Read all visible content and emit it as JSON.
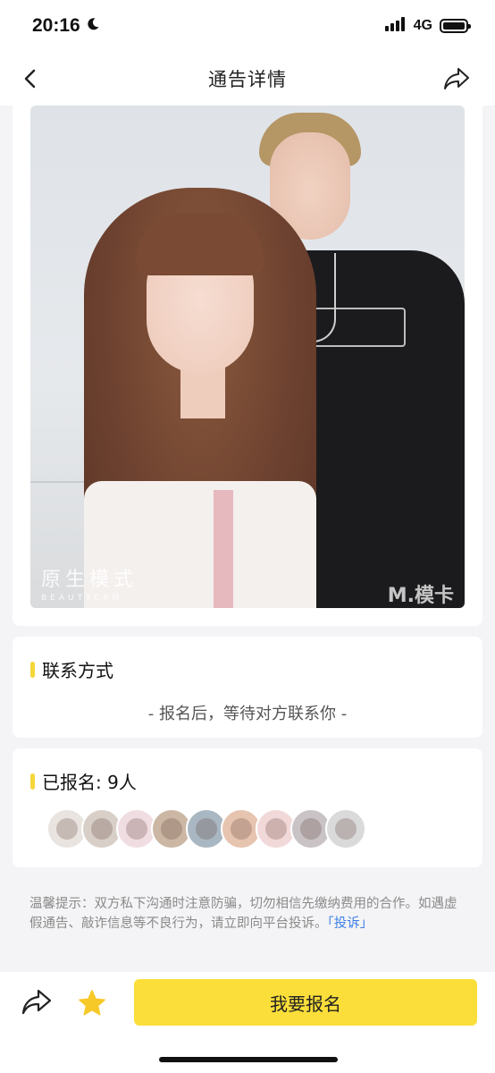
{
  "status_bar": {
    "time": "20:16",
    "network": "4G",
    "icons": [
      "moon-icon",
      "signal-icon",
      "battery-icon"
    ]
  },
  "nav": {
    "title": "通告详情",
    "icons": [
      "back-arrow-icon",
      "share-icon"
    ]
  },
  "photo": {
    "watermark_left_main": "原生模式",
    "watermark_left_sub": "BEAUTYCAM",
    "watermark_right": "M.模卡"
  },
  "contact": {
    "title": "联系方式",
    "note": "- 报名后，等待对方联系你 -"
  },
  "signup": {
    "title": "已报名: 9人",
    "avatar_count": 9,
    "avatar_colors": [
      "#e9e4df",
      "#d8cfc8",
      "#f0dde2",
      "#cbb7a4",
      "#a9b7c2",
      "#e6c4b0",
      "#f2d9d9",
      "#c9c3c6",
      "#dadada"
    ]
  },
  "tip": {
    "text": "温馨提示：双方私下沟通时注意防骗，切勿相信先缴纳费用的合作。如遇虚假通告、敲诈信息等不良行为，请立即向平台投诉。",
    "link": "「投诉」"
  },
  "bottom": {
    "apply_label": "我要报名",
    "icons": [
      "share-icon",
      "star-icon"
    ]
  },
  "colors": {
    "accent_yellow": "#fbde3a",
    "link_blue": "#3b7ee5",
    "background": "#f4f4f6"
  }
}
